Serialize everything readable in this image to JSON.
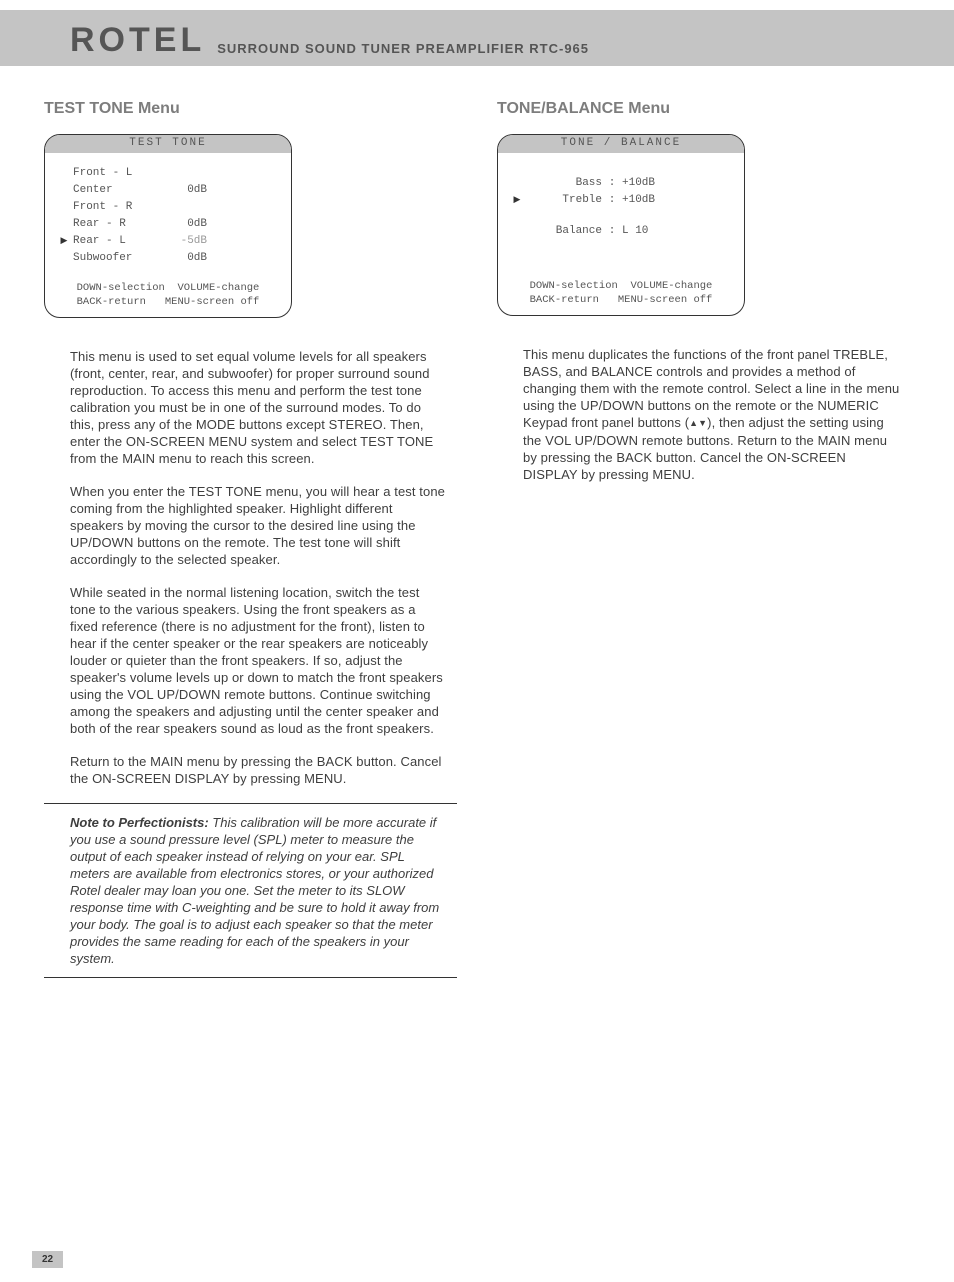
{
  "header": {
    "logo": "ROTEL",
    "title": "SURROUND SOUND TUNER PREAMPLIFIER  RTC-965"
  },
  "page_number": "22",
  "left": {
    "section_title": "TEST TONE Menu",
    "osd": {
      "title": "TEST TONE",
      "rows": [
        {
          "cursor": "",
          "label": "Front - L",
          "value": ""
        },
        {
          "cursor": "",
          "label": "Center",
          "value": "0dB"
        },
        {
          "cursor": "",
          "label": "Front - R",
          "value": ""
        },
        {
          "cursor": "",
          "label": "Rear - R",
          "value": "0dB"
        },
        {
          "cursor": "▶",
          "label": "Rear - L",
          "value": "-5dB",
          "hi": true
        },
        {
          "cursor": "",
          "label": "Subwoofer",
          "value": "0dB"
        }
      ],
      "footer1": "DOWN-selection  VOLUME-change",
      "footer2": "BACK-return   MENU-screen off"
    },
    "p1": "This menu is used to set equal volume levels for all speakers (front, center, rear, and subwoofer) for proper surround sound reproduction. To access this menu and perform the test tone calibration you must be in one of the surround modes. To do this, press any of the MODE buttons except STEREO. Then, enter the ON-SCREEN MENU system and select TEST TONE from the MAIN menu to reach this screen.",
    "p2": "When you enter the TEST TONE menu, you will hear a test tone coming from the highlighted speaker. Highlight different speakers by moving the cursor to the desired line using the UP/DOWN buttons on the remote. The test tone will shift accordingly to the selected speaker.",
    "p3": "While seated in the normal listening location, switch the test tone to the various speakers. Using the front speakers as a fixed reference (there is no adjustment for the front), listen to hear if the center speaker or the rear speakers are noticeably louder or quieter than the front speakers. If so, adjust the speaker's volume levels up or down to match the front speakers using the VOL UP/DOWN remote buttons. Continue switching among the speakers and adjusting until the center speaker and both of the rear speakers sound as loud as the front speakers.",
    "p4": "Return to the MAIN menu by pressing the BACK button. Cancel the ON-SCREEN DISPLAY by pressing MENU.",
    "note_label": "Note to Perfectionists:",
    "note_body": " This calibration will be more accurate if you use a sound pressure level (SPL) meter to measure the output of each speaker instead of relying on your ear. SPL meters are available from electronics stores, or your authorized Rotel dealer may loan you one. Set the meter to its SLOW response time with C-weighting and be sure to hold it away from your body. The goal is to adjust each speaker so that the meter provides the same reading for each of the speakers in your system."
  },
  "right": {
    "section_title": "TONE/BALANCE Menu",
    "osd": {
      "title": "TONE / BALANCE",
      "rows": [
        {
          "cursor": "",
          "label": "Bass",
          "value": "+10dB",
          "hi": true
        },
        {
          "cursor": "▶",
          "label": "Treble",
          "value": "+10dB",
          "hi": true
        }
      ],
      "balance": {
        "cursor": "",
        "label": "Balance",
        "value": "L 10"
      },
      "footer1": "DOWN-selection  VOLUME-change",
      "footer2": "BACK-return   MENU-screen off"
    },
    "p1a": "This menu duplicates the functions of the front panel TREBLE, BASS, and BALANCE controls and provides a method of changing them with the remote control. Select a line in the menu using the UP/DOWN buttons on the remote or the NUMERIC Keypad front panel buttons (",
    "p1b": "), then adjust the setting using the VOL UP/DOWN remote buttons. Return to the MAIN menu by pressing the BACK button. Cancel the ON-SCREEN DISPLAY by pressing MENU."
  }
}
